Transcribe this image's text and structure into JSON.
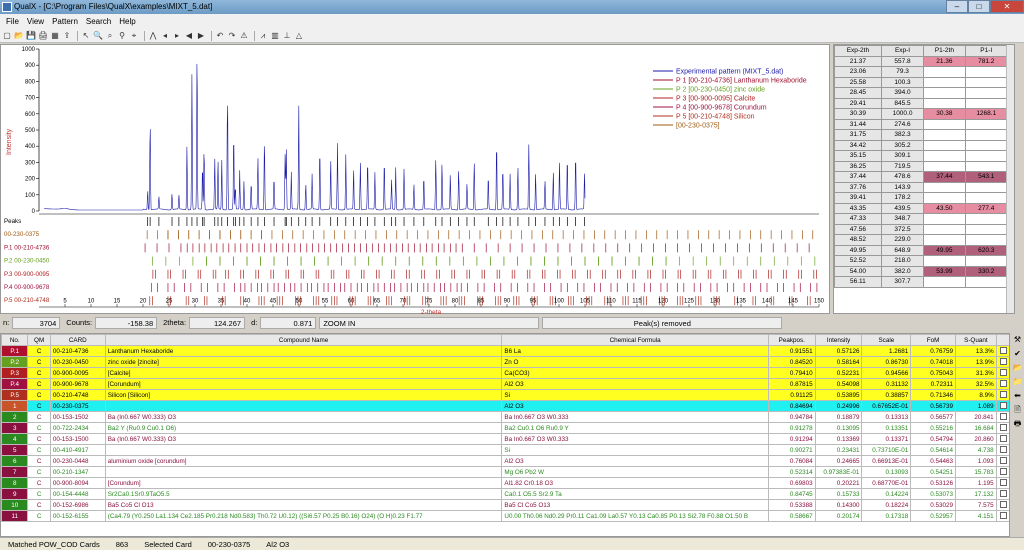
{
  "window": {
    "title": "QualX - [C:\\Program Files\\QualX\\examples\\MIXT_5.dat]"
  },
  "menu": [
    "File",
    "View",
    "Pattern",
    "Search",
    "Help"
  ],
  "toolbar_icons": [
    "new-icon",
    "open-icon",
    "save-icon",
    "print-icon",
    "chart-icon",
    "export-icon",
    "cursor-icon",
    "zoom-icon",
    "search-icon",
    "binoculars-icon",
    "find-icon",
    "peak-icon",
    "arrow-left-icon",
    "arrow-right-icon",
    "back-icon",
    "forward-icon",
    "undo-icon",
    "redo-icon",
    "warning-icon",
    "pattern-icon",
    "bars-icon",
    "stick-icon",
    "triangle-warning-icon"
  ],
  "chart_data": {
    "type": "line",
    "ylabel": "Intensity",
    "xlabel": "2-theta",
    "ylim": [
      0,
      1000
    ],
    "xlim": [
      0,
      150
    ],
    "yticks": [
      0,
      100,
      200,
      300,
      400,
      500,
      600,
      700,
      800,
      900,
      1000
    ],
    "xticks": [
      5,
      10,
      15,
      20,
      25,
      30,
      35,
      40,
      45,
      50,
      55,
      60,
      65,
      70,
      75,
      80,
      85,
      90,
      95,
      100,
      105,
      110,
      115,
      120,
      125,
      130,
      135,
      140,
      145,
      150
    ],
    "peaks": [
      [
        20.9,
        120
      ],
      [
        21.37,
        557
      ],
      [
        23.06,
        79
      ],
      [
        25.58,
        100
      ],
      [
        26.9,
        90
      ],
      [
        28.45,
        394
      ],
      [
        29.41,
        845
      ],
      [
        30.39,
        1000
      ],
      [
        31.44,
        274
      ],
      [
        31.75,
        382
      ],
      [
        33.8,
        310
      ],
      [
        34.42,
        305
      ],
      [
        35.15,
        309
      ],
      [
        36.25,
        719
      ],
      [
        37.44,
        478
      ],
      [
        37.76,
        143
      ],
      [
        38.6,
        240
      ],
      [
        39.41,
        178
      ],
      [
        40.8,
        170
      ],
      [
        42.1,
        330
      ],
      [
        43.35,
        439
      ],
      [
        45.2,
        200
      ],
      [
        47.33,
        348
      ],
      [
        47.56,
        372
      ],
      [
        48.52,
        229
      ],
      [
        49.95,
        648
      ],
      [
        51.3,
        160
      ],
      [
        52.52,
        218
      ],
      [
        54.0,
        382
      ],
      [
        56.1,
        310
      ],
      [
        57.4,
        410
      ],
      [
        59.0,
        340
      ],
      [
        60.5,
        250
      ],
      [
        61.8,
        290
      ],
      [
        63.2,
        310
      ],
      [
        64.6,
        230
      ],
      [
        66.4,
        310
      ],
      [
        67.8,
        180
      ],
      [
        68.6,
        260
      ],
      [
        70.2,
        250
      ],
      [
        72.1,
        160
      ],
      [
        74.0,
        210
      ],
      [
        76.3,
        320
      ],
      [
        77.5,
        290
      ],
      [
        79.1,
        220
      ],
      [
        80.7,
        250
      ],
      [
        82.3,
        160
      ],
      [
        83.7,
        300
      ],
      [
        86.4,
        210
      ],
      [
        88.0,
        430
      ],
      [
        89.2,
        260
      ],
      [
        90.6,
        220
      ],
      [
        92.1,
        270
      ],
      [
        94.2,
        400
      ],
      [
        95.5,
        230
      ],
      [
        97.3,
        180
      ],
      [
        98.9,
        240
      ],
      [
        100.1,
        300
      ],
      [
        101.6,
        330
      ],
      [
        103.2,
        350
      ],
      [
        104.9,
        230
      ]
    ],
    "legend": [
      {
        "name": "Experimental pattern (MIXT_5.dat)",
        "color": "#1a1aa8"
      },
      {
        "name": "P 1 [00-210-4736] Lanthanum Hexaboride",
        "color": "#a01030"
      },
      {
        "name": "P 2 [00-230-0450] zinc oxide",
        "color": "#66a020"
      },
      {
        "name": "P 3 [00-900-0095] Calcite",
        "color": "#b02020"
      },
      {
        "name": "P 4 [00-900-9678] Corundum",
        "color": "#a01040"
      },
      {
        "name": "P 5 [00-210-4748] Silicon",
        "color": "#b03020"
      },
      {
        "name": "[00-230-0375]",
        "color": "#a05a10"
      }
    ],
    "tick_rows": [
      {
        "label": "Peaks",
        "color": "#000000"
      },
      {
        "label": "00-230-0375",
        "color": "#a05a10"
      },
      {
        "label": "P.1 00-210-4736",
        "color": "#a01030"
      },
      {
        "label": "P.2 00-230-0450",
        "color": "#66a020"
      },
      {
        "label": "P.3 00-900-0095",
        "color": "#b02020"
      },
      {
        "label": "P.4 00-900-9678",
        "color": "#a01040"
      },
      {
        "label": "P.5 00-210-4748",
        "color": "#b03020"
      }
    ]
  },
  "right_grid": {
    "headers": [
      "Exp-2th",
      "Exp-I",
      "P1-2th",
      "P1-I",
      "P"
    ],
    "rows": [
      [
        "21.37",
        "557.8",
        "21.36",
        "781.2",
        ""
      ],
      [
        "23.06",
        "79.3",
        "",
        "",
        ""
      ],
      [
        "25.58",
        "100.3",
        "",
        "",
        ""
      ],
      [
        "28.45",
        "394.0",
        "",
        "",
        ""
      ],
      [
        "29.41",
        "845.5",
        "",
        "",
        ""
      ],
      [
        "30.39",
        "1000.0",
        "30.38",
        "1268.1",
        ""
      ],
      [
        "31.44",
        "274.6",
        "",
        "",
        ""
      ],
      [
        "31.75",
        "382.3",
        "",
        "",
        ""
      ],
      [
        "34.42",
        "305.2",
        "",
        "",
        ""
      ],
      [
        "35.15",
        "309.1",
        "",
        "",
        ""
      ],
      [
        "36.25",
        "719.5",
        "",
        "",
        ""
      ],
      [
        "37.44",
        "478.6",
        "37.44",
        "543.1",
        ""
      ],
      [
        "37.76",
        "143.9",
        "",
        "",
        ""
      ],
      [
        "39.41",
        "178.2",
        "",
        "",
        ""
      ],
      [
        "43.35",
        "439.5",
        "43.50",
        "277.4",
        ""
      ],
      [
        "47.33",
        "348.7",
        "",
        "",
        ""
      ],
      [
        "47.56",
        "372.5",
        "",
        "",
        ""
      ],
      [
        "48.52",
        "229.0",
        "",
        "",
        ""
      ],
      [
        "49.95",
        "648.9",
        "49.95",
        "620.3",
        ""
      ],
      [
        "52.52",
        "218.0",
        "",
        "",
        ""
      ],
      [
        "54.00",
        "382.0",
        "53.99",
        "330.2",
        ""
      ],
      [
        "56.11",
        "307.7",
        "",
        "",
        ""
      ]
    ]
  },
  "status": {
    "n_label": "n:",
    "n_value": "3704",
    "counts_label": "Counts:",
    "counts_value": "-158.38",
    "theta_label": "2theta:",
    "theta_value": "124.267",
    "d_label": "d:",
    "d_value": "0.871",
    "mode": "ZOOM IN",
    "message": "Peak(s) removed"
  },
  "card_table": {
    "headers": [
      "No.",
      "QM",
      "CARD",
      "Compound Name",
      "Chemical Formula",
      "Peakpos.",
      "Intensity",
      "Scale",
      "FoM",
      "S-Quant"
    ],
    "rows": [
      {
        "no": "P.1",
        "qm": "C",
        "card": "00-210-4736",
        "name": "Lanthanum Hexaboride",
        "formula": "B6 La",
        "peak": "0.91551",
        "int": "0.57126",
        "scale": "1.2681",
        "fom": "0.76759",
        "sq": "13.3%",
        "style": "phase"
      },
      {
        "no": "P.2",
        "qm": "C",
        "card": "00-230-0450",
        "name": "zinc oxide [zincite]",
        "formula": "Zn O",
        "peak": "0.84520",
        "int": "0.58164",
        "scale": "0.86730",
        "fom": "0.74018",
        "sq": "13.9%",
        "style": "phase"
      },
      {
        "no": "P.3",
        "qm": "C",
        "card": "00-900-0095",
        "name": "[Calcite]",
        "formula": "Ca(CO3)",
        "peak": "0.79410",
        "int": "0.52231",
        "scale": "0.94566",
        "fom": "0.75043",
        "sq": "31.3%",
        "style": "phase"
      },
      {
        "no": "P.4",
        "qm": "C",
        "card": "00-900-9678",
        "name": "[Corundum]",
        "formula": "Al2 O3",
        "peak": "0.87815",
        "int": "0.54098",
        "scale": "0.31132",
        "fom": "0.72311",
        "sq": "32.5%",
        "style": "phase"
      },
      {
        "no": "P.5",
        "qm": "C",
        "card": "00-210-4748",
        "name": "Silicon [Silicon]",
        "formula": "Si",
        "peak": "0.91125",
        "int": "0.53895",
        "scale": "0.38857",
        "fom": "0.71346",
        "sq": "8.9%",
        "style": "phase"
      },
      {
        "no": "1",
        "qm": "C",
        "card": "00-230-0375",
        "name": "",
        "formula": "Al2 O3",
        "peak": "0.84694",
        "int": "0.24996",
        "scale": "0.67652E-01",
        "fom": "0.56739",
        "sq": "1.089",
        "style": "selected"
      },
      {
        "no": "2",
        "qm": "C",
        "card": "00-153-1502",
        "name": "Ba (In0.667 W0.333) O3",
        "formula": "Ba In0.667 O3 W0.333",
        "peak": "0.94784",
        "int": "0.18879",
        "scale": "0.13313",
        "fom": "0.56577",
        "sq": "20.841",
        "style": "normal"
      },
      {
        "no": "3",
        "qm": "C",
        "card": "00-722-2434",
        "name": "Ba2 Y (Ru0.9 Cu0.1 O6)",
        "formula": "Ba2 Cu0.1 O6 Ru0.9 Y",
        "peak": "0.91278",
        "int": "0.13095",
        "scale": "0.13351",
        "fom": "0.55216",
        "sq": "16.684",
        "style": "normal"
      },
      {
        "no": "4",
        "qm": "C",
        "card": "00-153-1500",
        "name": "Ba (In0.667 W0.333) O3",
        "formula": "Ba In0.667 O3 W0.333",
        "peak": "0.91294",
        "int": "0.13369",
        "scale": "0.13371",
        "fom": "0.54794",
        "sq": "20.860",
        "style": "normal"
      },
      {
        "no": "5",
        "qm": "C",
        "card": "00-410-4917",
        "name": "",
        "formula": "Si",
        "peak": "0.90271",
        "int": "0.23431",
        "scale": "0.73710E-01",
        "fom": "0.54614",
        "sq": "4.738",
        "style": "normal"
      },
      {
        "no": "6",
        "qm": "C",
        "card": "00-230-0448",
        "name": "aluminium oxide [corundum]",
        "formula": "Al2 O3",
        "peak": "0.76084",
        "int": "0.24665",
        "scale": "0.66913E-01",
        "fom": "0.54463",
        "sq": "1.093",
        "style": "normal"
      },
      {
        "no": "7",
        "qm": "C",
        "card": "00-210-1347",
        "name": "",
        "formula": "Mg O6 Pb2 W",
        "peak": "0.52314",
        "int": "0.97383E-01",
        "scale": "0.13093",
        "fom": "0.54251",
        "sq": "15.783",
        "style": "normal"
      },
      {
        "no": "8",
        "qm": "C",
        "card": "00-900-8094",
        "name": "[Corundum]",
        "formula": "Al1.82 Cr0.18 O3",
        "peak": "0.69803",
        "int": "0.20221",
        "scale": "0.68770E-01",
        "fom": "0.53126",
        "sq": "1.195",
        "style": "normal"
      },
      {
        "no": "9",
        "qm": "C",
        "card": "00-154-4448",
        "name": "Sr2Ca0.1Sr0.9TaO5.5",
        "formula": "Ca0.1 O5.5 Sr2.9 Ta",
        "peak": "0.84745",
        "int": "0.15733",
        "scale": "0.14224",
        "fom": "0.53073",
        "sq": "17.132",
        "style": "normal"
      },
      {
        "no": "10",
        "qm": "C",
        "card": "00-152-6986",
        "name": "Ba5 Co5 Cl O13",
        "formula": "Ba5 Cl Co5 O13",
        "peak": "0.53388",
        "int": "0.14300",
        "scale": "0.18224",
        "fom": "0.53029",
        "sq": "7.575",
        "style": "normal"
      },
      {
        "no": "11",
        "qm": "C",
        "card": "00-152-6155",
        "name": "(Ca4.79 (Y0.250 La1.134 Ce2.185 Pr0.218 Nd0.583) Th0.72 U0.12) ((Si6.57 P0.25 B0.16) O24) (O H)0.23 F1.77",
        "formula": "U0.00 Th0.06 Nd0.29 Pr0.11 Ca1.09 La0.57 Y0.13 Ca0.85 P0.13 Si2.78 F0.88 O1.50 B",
        "peak": "0.58667",
        "int": "0.20174",
        "scale": "0.17318",
        "fom": "0.52957",
        "sq": "4.151",
        "style": "normal"
      }
    ]
  },
  "side_icons": [
    "tools-icon",
    "checkmark-icon",
    "folder-up-icon",
    "folder-icon",
    "arrow-left-icon",
    "document-icon",
    "printer-icon"
  ],
  "bottom": {
    "matched_label": "Matched POW_COD Cards",
    "matched_value": "863",
    "selected_label": "Selected Card",
    "selected_card": "00-230-0375",
    "selected_formula": "Al2 O3"
  }
}
